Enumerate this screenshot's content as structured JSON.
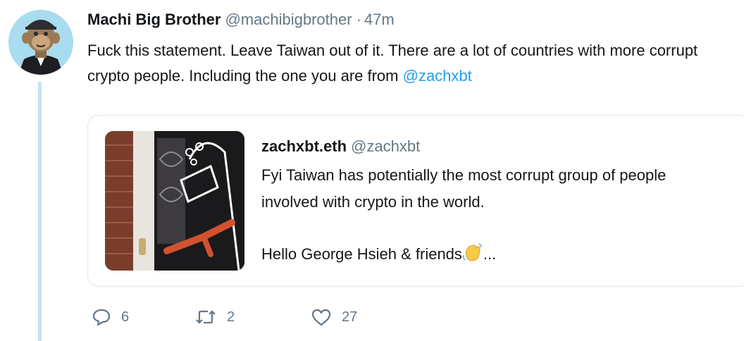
{
  "tweet": {
    "display_name": "Machi Big Brother",
    "handle": "@machibigbrother",
    "separator": "·",
    "time": "47m",
    "text": "Fuck this statement. Leave Taiwan out of it. There are a lot of countries with more corrupt crypto people. Including the one you are from ",
    "mention": "@zachxbt"
  },
  "quoted_tweet": {
    "display_name": "zachxbt.eth",
    "handle": "@zachxbt",
    "text_line1": "Fyi Taiwan has potentially the most corrupt group of people involved with crypto in the world.",
    "text_line2": "Hello George Hsieh & friends",
    "text_line2_suffix": "..."
  },
  "actions": {
    "reply_count": "6",
    "retweet_count": "2",
    "like_count": "27"
  },
  "icons": {
    "reply": "reply-bubble-icon",
    "retweet": "retweet-arrows-icon",
    "like": "heart-icon",
    "wave": "waving-hand-emoji"
  },
  "colors": {
    "link": "#1da1f2",
    "secondary_text": "#657786",
    "thread_line": "#c4e1f6",
    "card_border": "#e1e8ed"
  }
}
